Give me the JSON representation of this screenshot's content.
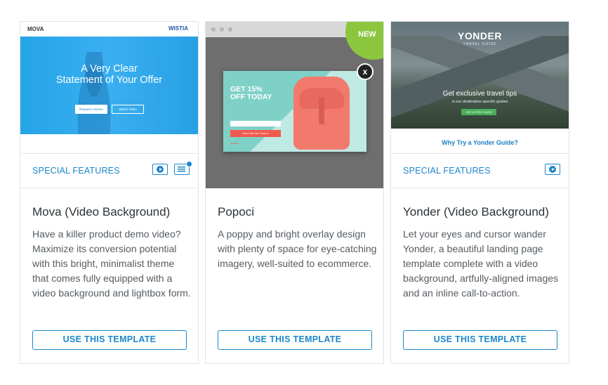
{
  "cards": [
    {
      "features_label": "SPECIAL FEATURES",
      "title": "Mova (Video Background)",
      "description": "Have a killer product demo video? Maximize its conversion potential with this bright, minimalist theme that comes fully equipped with a video background and lightbox form.",
      "button": "USE THIS TEMPLATE",
      "features": [
        "video-icon",
        "form-icon"
      ],
      "thumb": {
        "logo": "MOVA",
        "partner": "WISTIA",
        "headline_1": "A Very Clear",
        "headline_2": "Statement of Your Offer",
        "cta_primary": "Request A Demo",
        "cta_secondary": "Watch Video"
      }
    },
    {
      "features_label": "",
      "title": "Popoci",
      "description": "A poppy and bright overlay design with plenty of space for eye-catching imagery, well-suited to ecommerce.",
      "button": "USE THIS TEMPLATE",
      "badge": "NEW",
      "thumb": {
        "offer_line_1": "GET 15%",
        "offer_line_2": "OFF TODAY",
        "cta": "Send Me My Coupon",
        "brand": "popoci",
        "close": "x"
      }
    },
    {
      "features_label": "SPECIAL FEATURES",
      "title": "Yonder (Video Background)",
      "description": "Let your eyes and cursor wander Yonder, a beautiful landing page template complete with a video background, artfully-aligned images and an inline call-to-action.",
      "button": "USE THIS TEMPLATE",
      "features": [
        "video-icon"
      ],
      "thumb": {
        "logo": "YONDER",
        "logo_sub": "TRAVEL GUIDE",
        "headline": "Get exclusive travel tips",
        "subline": "in our destination-specific guides",
        "cta": "GET A FREE GUIDE",
        "section_title": "Why Try a Yonder Guide?"
      }
    }
  ],
  "colors": {
    "accent": "#1c87c9",
    "new_badge": "#8cc63f",
    "border": "#dfe3e6"
  }
}
